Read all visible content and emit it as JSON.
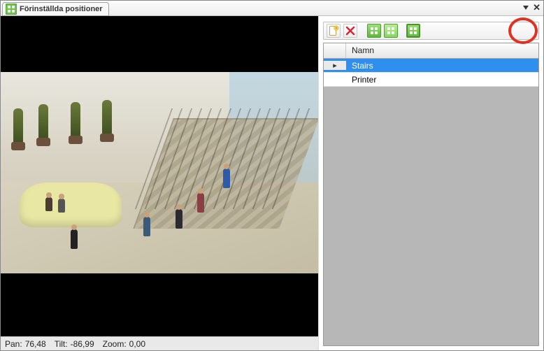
{
  "window": {
    "tab_title": "Förinställda positioner"
  },
  "status": {
    "pan_label": "Pan:",
    "pan_value": "76,48",
    "tilt_label": "Tilt:",
    "tilt_value": "-86,99",
    "zoom_label": "Zoom:",
    "zoom_value": "0,00"
  },
  "toolbar": {
    "icons": {
      "new": "new-page-icon",
      "delete": "delete-icon",
      "goto": "goto-grid-icon",
      "add_current": "add-current-grid-icon",
      "highlighted": "expand-grid-icon"
    }
  },
  "grid": {
    "header": "Namn",
    "rows": [
      {
        "name": "Stairs",
        "selected": true
      },
      {
        "name": "Printer",
        "selected": false
      }
    ]
  }
}
